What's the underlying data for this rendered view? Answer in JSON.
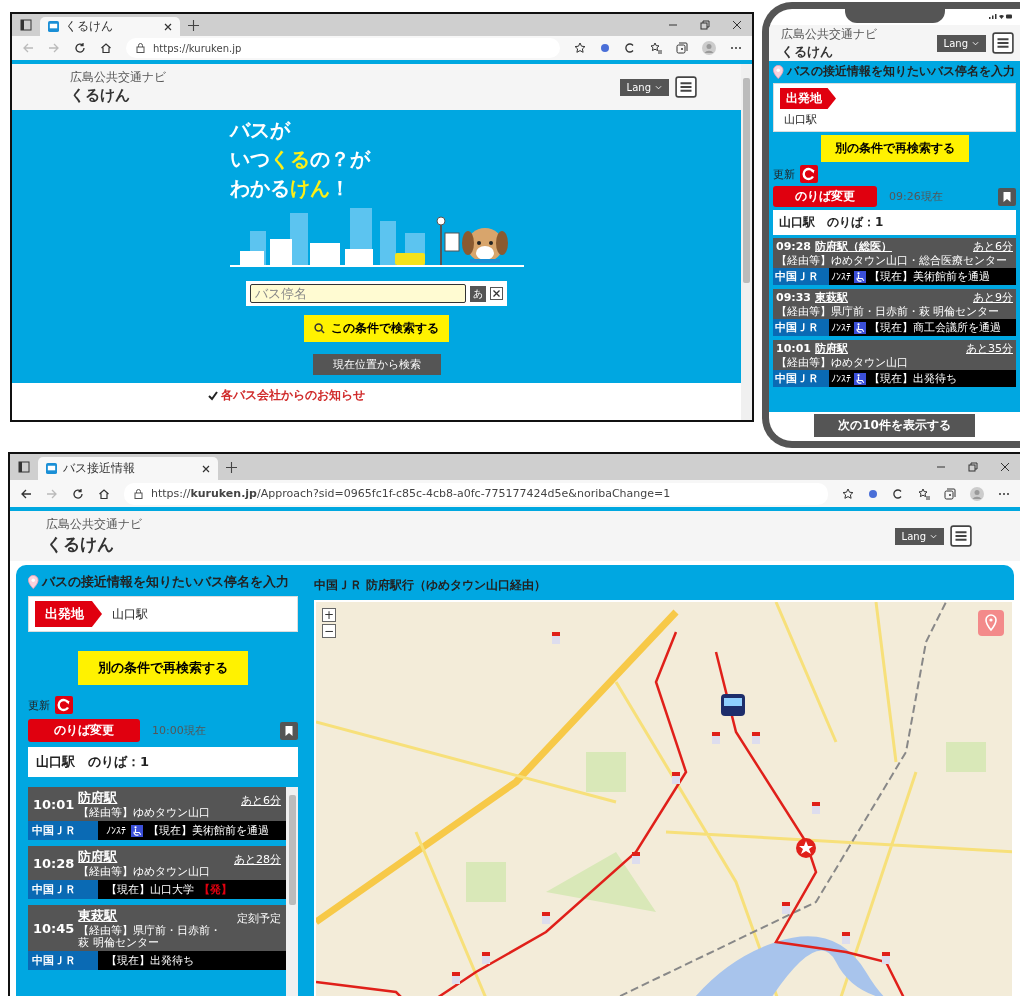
{
  "desktop_browser": {
    "tab_title": "くるけん",
    "url": "https://kuruken.jp",
    "header": {
      "subtitle": "広島公共交通ナビ",
      "logo": "くるけん",
      "lang": "Lang"
    },
    "hero": {
      "lines": [
        [
          {
            "text": "バスが",
            "accent": false
          }
        ],
        [
          {
            "text": "いつ",
            "accent": false
          },
          {
            "text": "くる",
            "accent": true
          },
          {
            "text": "の？が",
            "accent": false
          }
        ],
        [
          {
            "text": "わかる",
            "accent": false
          },
          {
            "text": "けん",
            "accent": true
          },
          {
            "text": "！",
            "accent": false
          }
        ]
      ]
    },
    "search": {
      "placeholder": "バス停名",
      "kana_button": "あ",
      "search_button": "この条件で検索する",
      "location_button": "現在位置から検索"
    },
    "notice": "各バス会社からのお知らせ"
  },
  "phone": {
    "header": {
      "subtitle": "広島公共交通ナビ",
      "logo": "くるけん",
      "lang": "Lang"
    },
    "prompt": "バスの接近情報を知りたいバス停名を入力",
    "origin_label": "出発地",
    "origin_value": "山口駅",
    "research_button": "別の条件で再検索する",
    "refresh_label": "更新",
    "platform_button": "のりば変更",
    "as_of": "09:26現在",
    "stop_title": "山口駅　のりば：1",
    "departures": [
      {
        "time": "09:28",
        "destination": "防府駅（総医）",
        "via": "【経由等】ゆめタウン山口・総合医療センター",
        "remaining": "あと6分",
        "remaining_link": true,
        "operator": "中国ＪＲ",
        "vehicle": "ﾉﾝｽﾃ",
        "wheelchair": true,
        "location": "【現在】美術館前を通過"
      },
      {
        "time": "09:33",
        "destination": "東萩駅",
        "via": "【経由等】県庁前・日赤前・萩 明倫センター",
        "remaining": "あと9分",
        "remaining_link": true,
        "operator": "中国ＪＲ",
        "vehicle": "ﾉﾝｽﾃ",
        "wheelchair": true,
        "location": "【現在】商工会議所を通過"
      },
      {
        "time": "10:01",
        "destination": "防府駅",
        "via": "【経由等】ゆめタウン山口",
        "remaining": "あと35分",
        "remaining_link": true,
        "operator": "中国ＪＲ",
        "vehicle": "ﾉﾝｽﾃ",
        "wheelchair": true,
        "location": "【現在】出発待ち"
      }
    ],
    "more_button": "次の10件を表示する"
  },
  "approach_browser": {
    "tab_title": "バス接近情報",
    "url": "https://**kuruken.jp**/Approach?sid=0965fc1f-c85c-4cb8-a0fc-775177424d5e&noribaChange=1",
    "header": {
      "subtitle": "広島公共交通ナビ",
      "logo": "くるけん",
      "lang": "Lang"
    },
    "prompt": "バスの接近情報を知りたいバス停名を入力",
    "origin_label": "出発地",
    "origin_value": "山口駅",
    "research_button": "別の条件で再検索する",
    "refresh_label": "更新",
    "platform_button": "のりば変更",
    "as_of": "10:00現在",
    "stop_title": "山口駅　のりば：1",
    "departures": [
      {
        "time": "10:01",
        "destination": "防府駅",
        "via": "【経由等】ゆめタウン山口",
        "remaining": "あと6分",
        "remaining_link": true,
        "operator": "中国ＪＲ",
        "vehicle": "ﾉﾝｽﾃ",
        "wheelchair": true,
        "location": "【現在】美術館前を通過"
      },
      {
        "time": "10:28",
        "destination": "防府駅",
        "via": "【経由等】ゆめタウン山口",
        "remaining": "あと28分",
        "remaining_link": true,
        "operator": "中国ＪＲ",
        "wheelchair": false,
        "location": "【現在】山口大学",
        "badge": "【発】"
      },
      {
        "time": "10:45",
        "destination": "東萩駅",
        "via": "【経由等】県庁前・日赤前・萩 明倫センター",
        "remaining": "定刻予定",
        "remaining_link": false,
        "operator": "中国ＪＲ",
        "wheelchair": false,
        "location": "【現在】出発待ち"
      }
    ],
    "map": {
      "title": "中国ＪＲ 防府駅行（ゆめタウン山口経由）",
      "zoom_in": "+",
      "zoom_out": "−"
    }
  }
}
